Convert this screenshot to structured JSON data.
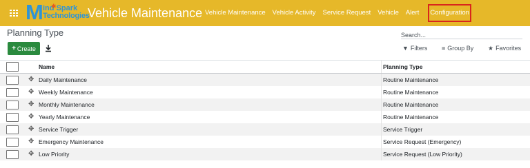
{
  "navbar": {
    "brand_word1": "ind",
    "brand_word1_suffix": "Spark",
    "brand_word2": "Technologies",
    "brand_letter": "M",
    "app_title": "Vehicle Maintenance",
    "menu": [
      {
        "label": "Vehicle Maintenance"
      },
      {
        "label": "Vehicle Activity"
      },
      {
        "label": "Service Request"
      },
      {
        "label": "Vehicle"
      },
      {
        "label": "Alert"
      },
      {
        "label": "Configuration"
      }
    ],
    "colors": {
      "bar": "#e6b829",
      "highlight_box": "#d9261c"
    }
  },
  "control_panel": {
    "breadcrumb": "Planning Type",
    "search_placeholder": "Search...",
    "create_label": "Create",
    "filters_label": "Filters",
    "group_by_label": "Group By",
    "favorites_label": "Favorites"
  },
  "table": {
    "columns": [
      "Name",
      "Planning Type"
    ],
    "rows": [
      {
        "name": "Daily Maintenance",
        "type": "Routine Maintenance"
      },
      {
        "name": "Weekly Maintenance",
        "type": "Routine Maintenance"
      },
      {
        "name": "Monthly Maintenance",
        "type": "Routine Maintenance"
      },
      {
        "name": "Yearly Maintenance",
        "type": "Routine Maintenance"
      },
      {
        "name": "Service Trigger",
        "type": "Service Trigger"
      },
      {
        "name": "Emergency Maintenance",
        "type": "Service Request (Emergency)"
      },
      {
        "name": "Low Priority",
        "type": "Service Request (Low Priority)"
      }
    ]
  }
}
